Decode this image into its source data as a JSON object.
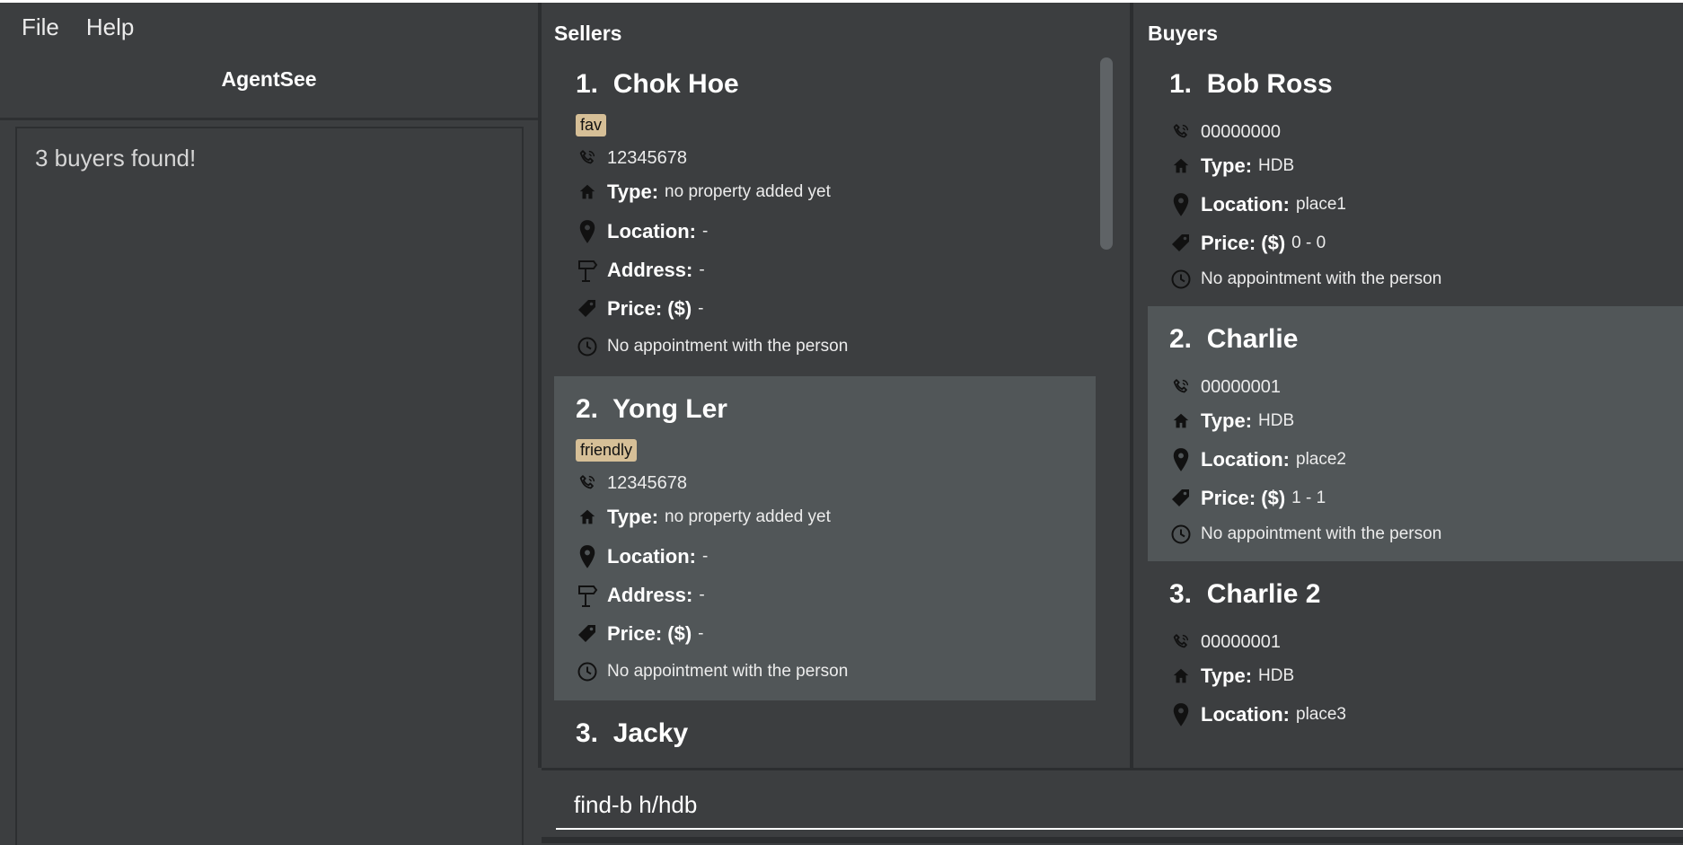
{
  "menu": {
    "file": "File",
    "help": "Help"
  },
  "app_title": "AgentSee",
  "result_message": "3 buyers found!",
  "sellers": {
    "title": "Sellers",
    "cards": [
      {
        "index": "1.",
        "name": "Chok Hoe",
        "tag": "fav",
        "phone": "12345678",
        "type_label": "Type:",
        "type": "no property added yet",
        "location_label": "Location:",
        "location": "-",
        "address_label": "Address:",
        "address": "-",
        "price_label": "Price: ($)",
        "price": " -",
        "appointment": "No appointment with the person"
      },
      {
        "index": "2.",
        "name": "Yong Ler",
        "tag": "friendly",
        "phone": "12345678",
        "type_label": "Type:",
        "type": "no property added yet",
        "location_label": "Location:",
        "location": "-",
        "address_label": "Address:",
        "address": "-",
        "price_label": "Price: ($)",
        "price": " -",
        "appointment": "No appointment with the person"
      },
      {
        "index": "3.",
        "name": "Jacky"
      }
    ]
  },
  "buyers": {
    "title": "Buyers",
    "cards": [
      {
        "index": "1.",
        "name": "Bob Ross",
        "phone": "00000000",
        "type_label": "Type:",
        "type": "HDB",
        "location_label": "Location:",
        "location": "place1",
        "price_label": "Price: ($)",
        "price": "0 - 0",
        "appointment": "No appointment with the person"
      },
      {
        "index": "2.",
        "name": "Charlie",
        "phone": "00000001",
        "type_label": "Type:",
        "type": "HDB",
        "location_label": "Location:",
        "location": "place2",
        "price_label": "Price: ($)",
        "price": "1 - 1",
        "appointment": "No appointment with the person"
      },
      {
        "index": "3.",
        "name": "Charlie 2",
        "phone": "00000001",
        "type_label": "Type:",
        "type": "HDB",
        "location_label": "Location:",
        "location": "place3"
      }
    ]
  },
  "command": {
    "value": "find-b h/hdb"
  },
  "colors": {
    "background": "#3c3e40",
    "card_highlight": "#515658",
    "tag": "#d6bf97",
    "divider": "#2c2e30"
  },
  "icons": [
    "phone-icon",
    "house-icon",
    "location-pin-icon",
    "signpost-icon",
    "price-tag-icon",
    "clock-icon"
  ]
}
